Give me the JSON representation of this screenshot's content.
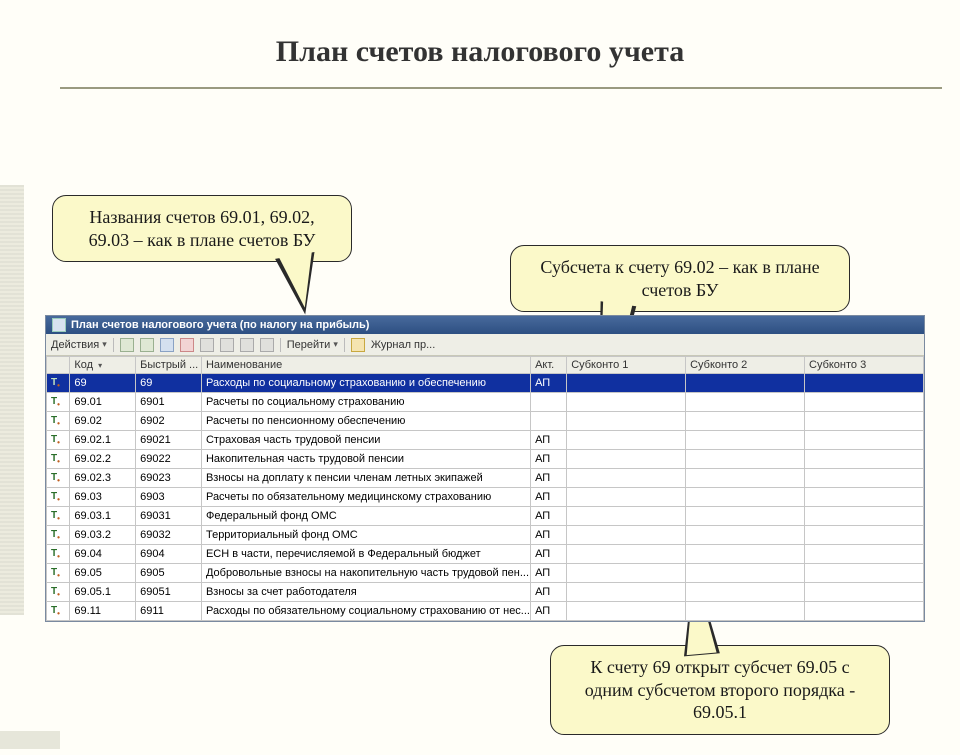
{
  "slide": {
    "title": "План счетов налогового учета"
  },
  "callouts": {
    "c1": "Названия счетов 69.01, 69.02, 69.03 – как в плане счетов БУ",
    "c2": "Субсчета к счету 69.02 – как в плане счетов БУ",
    "c3": "К счету 69 открыт субсчет 69.05 с одним субсчетом второго порядка - 69.05.1"
  },
  "window": {
    "title": "План счетов налогового учета (по налогу на прибыль)"
  },
  "toolbar": {
    "actions": "Действия",
    "goto": "Перейти",
    "journal": "Журнал пр..."
  },
  "grid": {
    "headers": {
      "code": "Код",
      "fast": "Быстрый ...",
      "name": "Наименование",
      "act": "Акт.",
      "sub1": "Субконто 1",
      "sub2": "Субконто 2",
      "sub3": "Субконто 3"
    },
    "rows": [
      {
        "code": "69",
        "fast": "69",
        "name": "Расходы по социальному страхованию и обеспечению",
        "act": "АП",
        "sel": true
      },
      {
        "code": "69.01",
        "fast": "6901",
        "name": "Расчеты по социальному страхованию",
        "act": "",
        "sel": false
      },
      {
        "code": "69.02",
        "fast": "6902",
        "name": "Расчеты по пенсионному обеспечению",
        "act": "",
        "sel": false
      },
      {
        "code": "69.02.1",
        "fast": "69021",
        "name": "Страховая часть трудовой пенсии",
        "act": "АП",
        "sel": false
      },
      {
        "code": "69.02.2",
        "fast": "69022",
        "name": "Накопительная часть трудовой пенсии",
        "act": "АП",
        "sel": false
      },
      {
        "code": "69.02.3",
        "fast": "69023",
        "name": "Взносы на доплату к пенсии членам летных экипажей",
        "act": "АП",
        "sel": false
      },
      {
        "code": "69.03",
        "fast": "6903",
        "name": "Расчеты по обязательному медицинскому страхованию",
        "act": "АП",
        "sel": false
      },
      {
        "code": "69.03.1",
        "fast": "69031",
        "name": "Федеральный фонд ОМС",
        "act": "АП",
        "sel": false
      },
      {
        "code": "69.03.2",
        "fast": "69032",
        "name": "Территориальный фонд ОМС",
        "act": "АП",
        "sel": false
      },
      {
        "code": "69.04",
        "fast": "6904",
        "name": "ЕСН в части, перечисляемой в Федеральный бюджет",
        "act": "АП",
        "sel": false
      },
      {
        "code": "69.05",
        "fast": "6905",
        "name": "Добровольные взносы на накопительную часть трудовой пен...",
        "act": "АП",
        "sel": false
      },
      {
        "code": "69.05.1",
        "fast": "69051",
        "name": "Взносы за счет работодателя",
        "act": "АП",
        "sel": false
      },
      {
        "code": "69.11",
        "fast": "6911",
        "name": "Расходы по обязательному социальному страхованию от нес...",
        "act": "АП",
        "sel": false
      }
    ]
  }
}
